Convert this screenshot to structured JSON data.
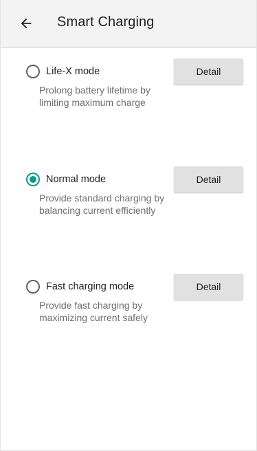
{
  "header": {
    "back_icon": "arrow-left-icon",
    "title": "Smart Charging"
  },
  "modes": [
    {
      "label": "Life-X mode",
      "description": "Prolong battery lifetime by limiting maximum charge",
      "selected": false,
      "detail_label": "Detail"
    },
    {
      "label": "Normal mode",
      "description": "Provide standard charging by balancing current efficiently",
      "selected": true,
      "detail_label": "Detail"
    },
    {
      "label": "Fast charging mode",
      "description": "Provide fast charging by maximizing current safely",
      "selected": false,
      "detail_label": "Detail"
    }
  ],
  "colors": {
    "accent": "#0b9a8a",
    "app_bar": "#f3f3f3",
    "button": "#e1e1e1"
  }
}
